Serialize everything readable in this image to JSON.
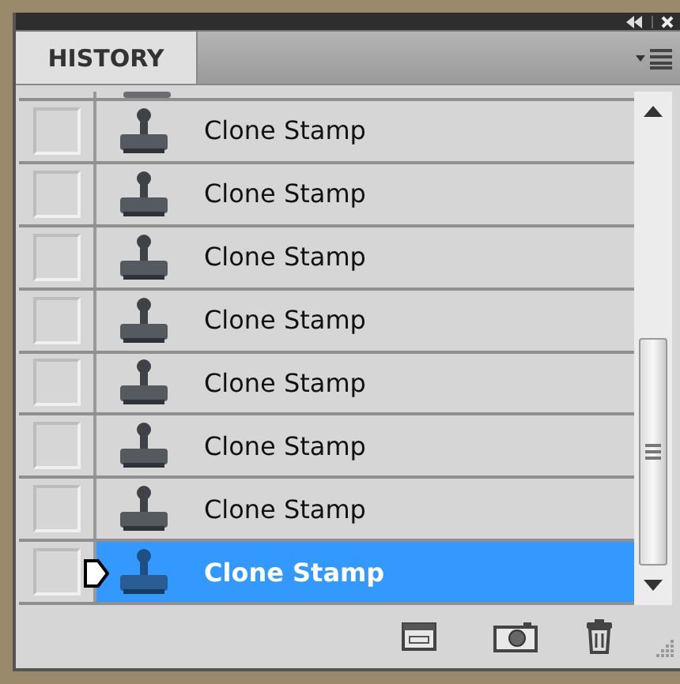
{
  "panel": {
    "tab": {
      "label": "HISTORY",
      "selected": true
    }
  },
  "rows": [
    {
      "label": "Clone Stamp",
      "selected": false,
      "source": false
    },
    {
      "label": "Clone Stamp",
      "selected": false,
      "source": false
    },
    {
      "label": "Clone Stamp",
      "selected": false,
      "source": false
    },
    {
      "label": "Clone Stamp",
      "selected": false,
      "source": false
    },
    {
      "label": "Clone Stamp",
      "selected": false,
      "source": false
    },
    {
      "label": "Clone Stamp",
      "selected": false,
      "source": false
    },
    {
      "label": "Clone Stamp",
      "selected": false,
      "source": false
    },
    {
      "label": "Clone Stamp",
      "selected": true,
      "source": false
    }
  ]
}
